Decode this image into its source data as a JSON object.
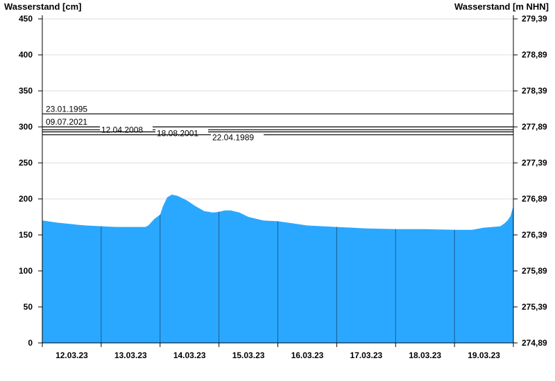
{
  "chart_data": {
    "type": "area",
    "ylabel_left": "Wasserstand [cm]",
    "ylabel_right": "Wasserstand [m NHN]",
    "ylim": [
      0,
      455
    ],
    "y_ticks_left": [
      0,
      50,
      100,
      150,
      200,
      250,
      300,
      350,
      400,
      450
    ],
    "y_ticks_right": [
      "274,89",
      "275,39",
      "275,89",
      "276,39",
      "276,89",
      "277,39",
      "277,89",
      "278,39",
      "278,89",
      "279,39"
    ],
    "x_range_days": [
      0,
      8
    ],
    "x_tick_labels": [
      "12.03.23",
      "13.03.23",
      "14.03.23",
      "15.03.23",
      "16.03.23",
      "17.03.23",
      "18.03.23",
      "19.03.23"
    ],
    "grid": true,
    "fill_color": "#2aa8ff",
    "reference_lines": [
      {
        "label": "23.01.1995",
        "value": 318
      },
      {
        "label": "09.07.2021",
        "value": 300
      },
      {
        "label": "12.04.2008",
        "value": 296
      },
      {
        "label": "18.08.2001",
        "value": 293
      },
      {
        "label": "22.04.1989",
        "value": 289
      }
    ],
    "series": [
      {
        "x": [
          0,
          0.25,
          0.5,
          0.6,
          0.75,
          1.0,
          1.25,
          1.5,
          1.75,
          1.8,
          1.9,
          2.0,
          2.05,
          2.12,
          2.2,
          2.3,
          2.45,
          2.6,
          2.75,
          2.9,
          3.0,
          3.1,
          3.2,
          3.35,
          3.5,
          3.75,
          4.0,
          4.25,
          4.5,
          5.0,
          5.5,
          6.0,
          6.5,
          7.0,
          7.3,
          7.5,
          7.65,
          7.78,
          7.85,
          7.9,
          7.95,
          8.0
        ],
        "y": [
          170,
          167,
          165,
          164,
          163,
          162,
          161,
          161,
          161,
          163,
          172,
          178,
          190,
          202,
          206,
          204,
          198,
          190,
          183,
          181,
          182,
          184,
          184,
          181,
          175,
          170,
          169,
          166,
          163,
          161,
          159,
          158,
          158,
          157,
          157,
          160,
          161,
          162,
          166,
          170,
          176,
          190
        ]
      }
    ]
  }
}
